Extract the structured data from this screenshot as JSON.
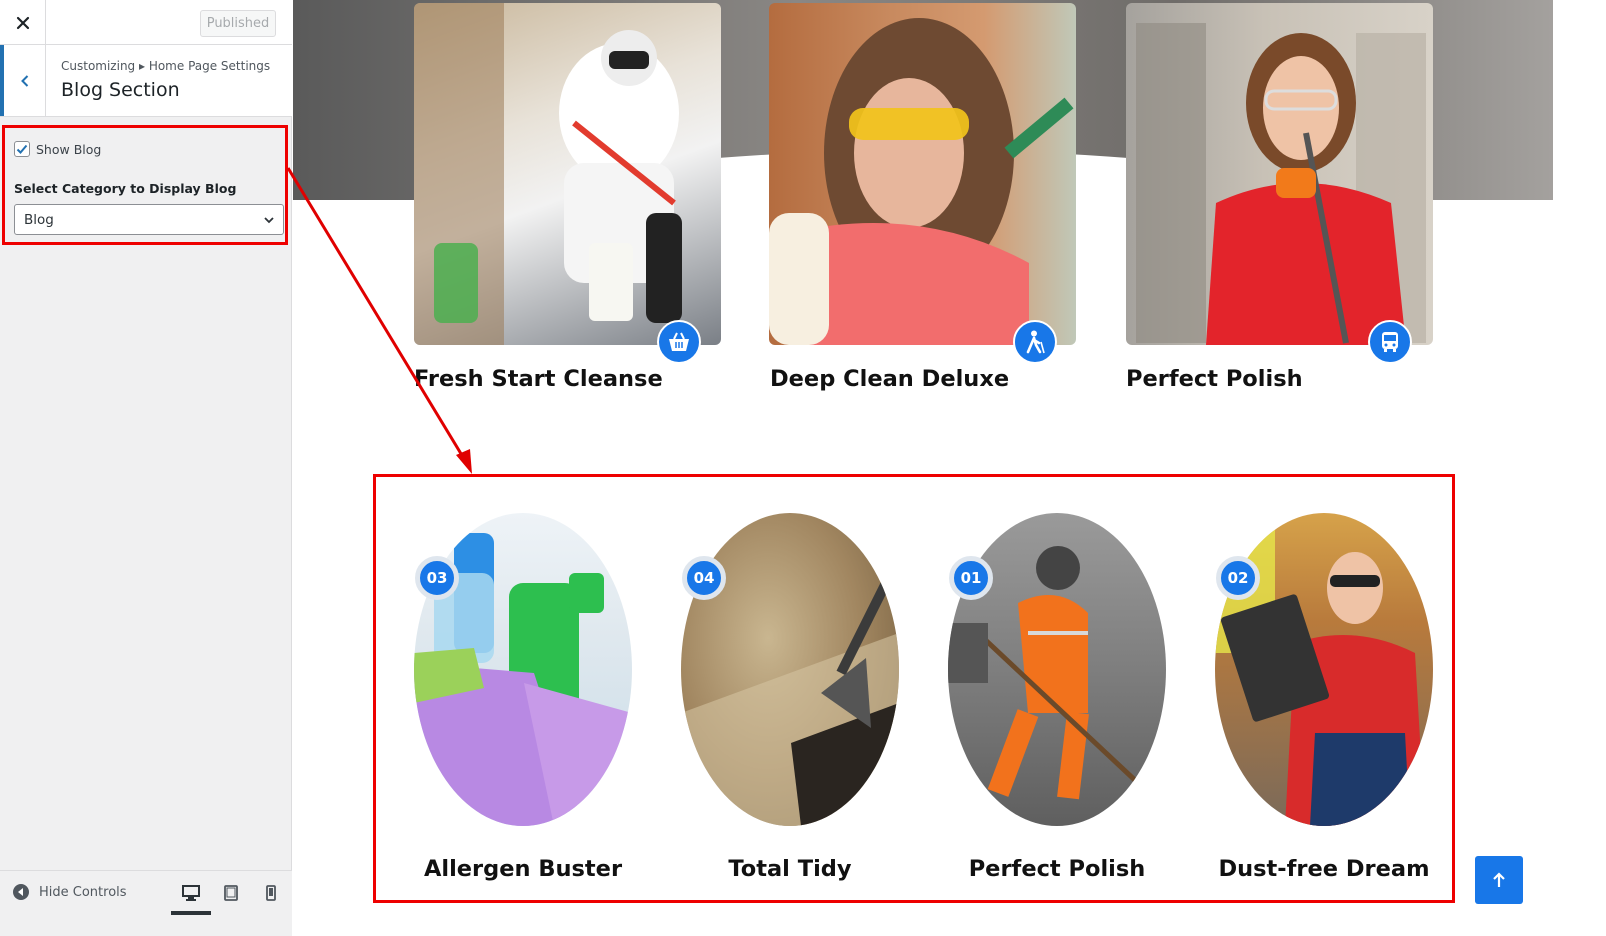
{
  "header": {
    "publish_label": "Published"
  },
  "section": {
    "breadcrumb": "Customizing ▸ Home Page Settings",
    "title": "Blog Section"
  },
  "controls": {
    "show_blog_label": "Show Blog",
    "show_blog_checked": true,
    "category_label": "Select Category to Display Blog",
    "category_value": "Blog"
  },
  "footer": {
    "hide_controls_label": "Hide Controls"
  },
  "services": [
    {
      "title": "Fresh Start Cleanse",
      "icon": "basket-icon"
    },
    {
      "title": "Deep Clean Deluxe",
      "icon": "person-walking-icon"
    },
    {
      "title": "Perfect Polish",
      "icon": "bus-icon"
    }
  ],
  "blog": [
    {
      "number": "03",
      "title": "Allergen Buster"
    },
    {
      "number": "04",
      "title": "Total Tidy"
    },
    {
      "number": "01",
      "title": "Perfect Polish"
    },
    {
      "number": "02",
      "title": "Dust-free Dream"
    }
  ],
  "colors": {
    "accent": "#1877e8",
    "highlight": "#e00000",
    "wp_blue": "#2271b1"
  }
}
